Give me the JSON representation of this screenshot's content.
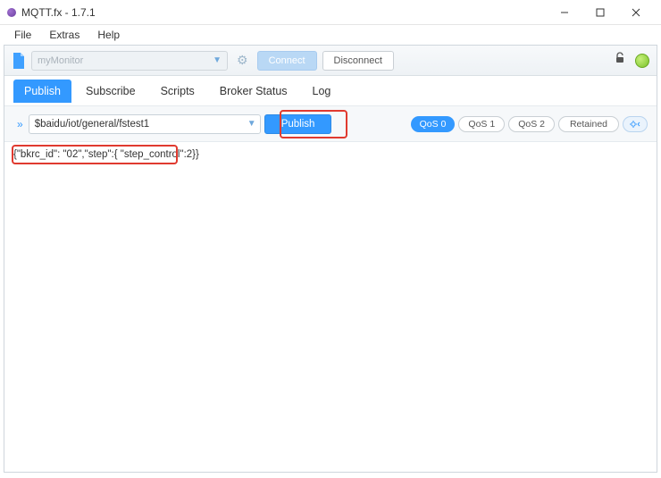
{
  "window": {
    "title": "MQTT.fx - 1.7.1"
  },
  "menubar": {
    "file": "File",
    "extras": "Extras",
    "help": "Help"
  },
  "connection": {
    "profile_placeholder": "myMonitor",
    "connect": "Connect",
    "disconnect": "Disconnect"
  },
  "tabs": {
    "publish": "Publish",
    "subscribe": "Subscribe",
    "scripts": "Scripts",
    "broker_status": "Broker Status",
    "log": "Log"
  },
  "publish": {
    "topic": "$baidu/iot/general/fstest1",
    "publish_button": "Publish",
    "qos0": "QoS 0",
    "qos1": "QoS 1",
    "qos2": "QoS 2",
    "retained": "Retained",
    "payload": "{\"bkrc_id\": \"02\",\"step\":{ \"step_control\":2}}"
  }
}
